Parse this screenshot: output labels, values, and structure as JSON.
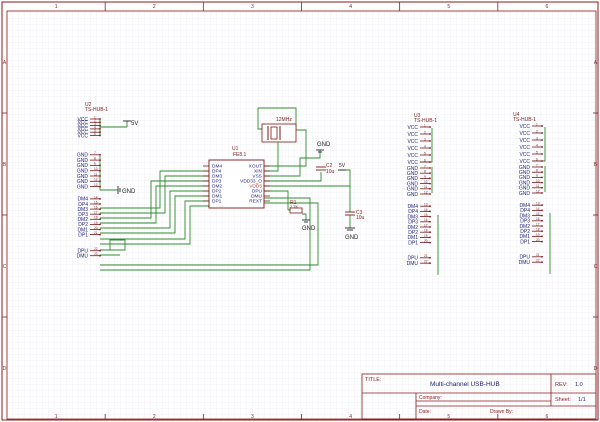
{
  "colors": {
    "border": "#8b1a1a",
    "wire": "#2e8b2e",
    "part": "#7a1818",
    "pin_text": "#1c1c7a",
    "grid": "#e6e6f0"
  },
  "frame": {
    "col_labels": [
      "1",
      "2",
      "3",
      "4",
      "5",
      "6"
    ],
    "row_labels": [
      "A",
      "B",
      "C",
      "D"
    ]
  },
  "title_block": {
    "title_label": "TITLE:",
    "title": "Multi-channel USB-HUB",
    "rev_label": "REV:",
    "rev": "1.0",
    "company_label": "Company:",
    "sheet_label": "Sheet:",
    "sheet": "1/1",
    "date_label": "Date:",
    "drawn_by_label": "Drawn By:"
  },
  "connector_left": {
    "ref": "U2",
    "value": "TS-HUB-1",
    "pins": [
      "VCC",
      "VCC",
      "VCC",
      "VCC",
      "VCC",
      "VCC",
      "GND",
      "GND",
      "GND",
      "GND",
      "GND",
      "GND",
      "GND",
      "DM4",
      "DP4",
      "DM3",
      "DP3",
      "DM2",
      "DP2",
      "DM1",
      "DP1",
      "DPU",
      "DMU"
    ]
  },
  "connector_mid": {
    "ref": "U3",
    "value": "TS-HUB-1",
    "pins": [
      "VCC",
      "VCC",
      "VCC",
      "VCC",
      "VCC",
      "VCC",
      "GND",
      "GND",
      "GND",
      "GND",
      "GND",
      "GND",
      "DM4",
      "DP4",
      "DM3",
      "DP3",
      "DM2",
      "DP2",
      "DM1",
      "DP1",
      "DPU",
      "DMU"
    ]
  },
  "connector_right": {
    "ref": "U4",
    "value": "TS-HUB-1",
    "pins": [
      "VCC",
      "VCC",
      "VCC",
      "VCC",
      "VCC",
      "VCC",
      "GND",
      "GND",
      "GND",
      "GND",
      "GND",
      "GND",
      "DM4",
      "DP4",
      "DM3",
      "DP3",
      "DM2",
      "DP2",
      "DM1",
      "DP1",
      "DPU",
      "DMU"
    ]
  },
  "ic": {
    "ref": "U1",
    "value": "FE8.1",
    "left_pins": [
      "DM4",
      "DP4",
      "DM3",
      "DP3",
      "DM2",
      "DP2",
      "DM1",
      "DP1"
    ],
    "right_pins": [
      "XOUT",
      "XIN",
      "VSS",
      "VDD33_O",
      "VDD5",
      "DPU",
      "DMU",
      "REXT"
    ]
  },
  "crystal": {
    "value": "12MHz",
    "ref": "Y1"
  },
  "caps": [
    {
      "ref": "C2",
      "value": "10u"
    },
    {
      "ref": "C3",
      "value": "10u"
    }
  ],
  "resistor": {
    "ref": "R1",
    "value": "2.7K"
  },
  "power": {
    "vcc_label": "5V",
    "gnd_label": "GND"
  }
}
